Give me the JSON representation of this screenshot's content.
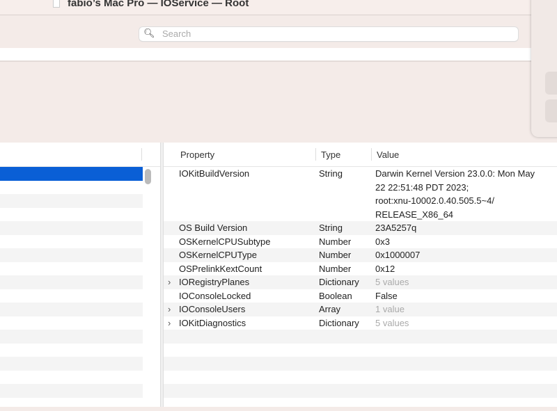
{
  "window": {
    "title": "fabio’s Mac Pro — IOService — Root"
  },
  "search": {
    "placeholder": "Search",
    "icon": "magnifier-dropdown-icon"
  },
  "table": {
    "headers": [
      "Property",
      "Type",
      "Value"
    ],
    "rows": [
      {
        "property": "IOKitBuildVersion",
        "type": "String",
        "value": "Darwin Kernel Version 23.0.0: Mon May\n22 22:51:48 PDT 2023;\nroot:xnu-10002.0.40.505.5~4/\nRELEASE_X86_64",
        "expandable": false,
        "dim": false
      },
      {
        "property": "OS Build Version",
        "type": "String",
        "value": "23A5257q",
        "expandable": false,
        "dim": false
      },
      {
        "property": "OSKernelCPUSubtype",
        "type": "Number",
        "value": "0x3",
        "expandable": false,
        "dim": false
      },
      {
        "property": "OSKernelCPUType",
        "type": "Number",
        "value": "0x1000007",
        "expandable": false,
        "dim": false
      },
      {
        "property": "OSPrelinkKextCount",
        "type": "Number",
        "value": "0x12",
        "expandable": false,
        "dim": false
      },
      {
        "property": "IORegistryPlanes",
        "type": "Dictionary",
        "value": "5 values",
        "expandable": true,
        "dim": true
      },
      {
        "property": "IOConsoleLocked",
        "type": "Boolean",
        "value": "False",
        "expandable": false,
        "dim": false
      },
      {
        "property": "IOConsoleUsers",
        "type": "Array",
        "value": "1 value",
        "expandable": true,
        "dim": true
      },
      {
        "property": "IOKitDiagnostics",
        "type": "Dictionary",
        "value": "5 values",
        "expandable": true,
        "dim": true
      }
    ]
  },
  "chevron": "›"
}
